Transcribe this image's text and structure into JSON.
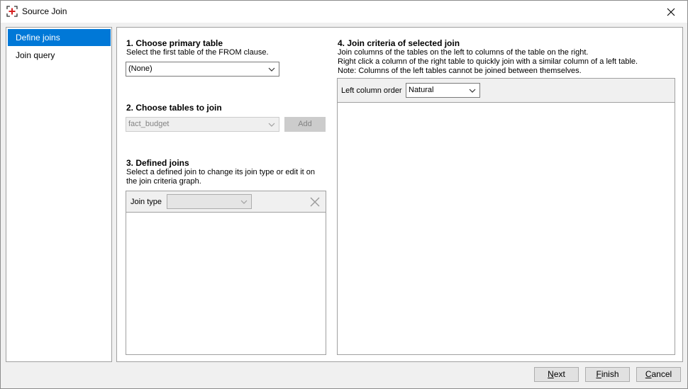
{
  "window": {
    "title": "Source Join",
    "close_icon": "close-icon",
    "app_icon": "source-join-icon"
  },
  "sidebar": {
    "items": [
      {
        "label": "Define joins",
        "active": true
      },
      {
        "label": "Join query",
        "active": false
      }
    ]
  },
  "section1": {
    "title": "1. Choose primary table",
    "description": "Select the first table of the FROM clause.",
    "primary_table_value": "(None)"
  },
  "section2": {
    "title": "2. Choose tables to join",
    "table_value": "fact_budget",
    "add_label": "Add"
  },
  "section3": {
    "title": "3. Defined joins",
    "description_line1": "Select a defined join to change its join type or edit it on",
    "description_line2": "the join criteria graph.",
    "join_type_label": "Join type",
    "join_type_value": ""
  },
  "section4": {
    "title": "4. Join criteria of selected join",
    "description_line1": "Join columns of the tables on the left to columns of the table on the right.",
    "description_line2": "Right click a column of the right table to quickly join with a similar column of a left table.",
    "description_line3": "Note: Columns of the left tables cannot be joined between themselves.",
    "left_column_order_label": "Left column order",
    "left_column_order_value": "Natural"
  },
  "footer": {
    "next": {
      "mnemonic": "N",
      "rest": "ext"
    },
    "finish": {
      "mnemonic": "F",
      "rest": "inish"
    },
    "cancel": {
      "mnemonic": "C",
      "rest": "ancel"
    }
  },
  "colors": {
    "accent": "#0078d7",
    "disabled_text": "#838383",
    "border": "#a0a0a0"
  }
}
